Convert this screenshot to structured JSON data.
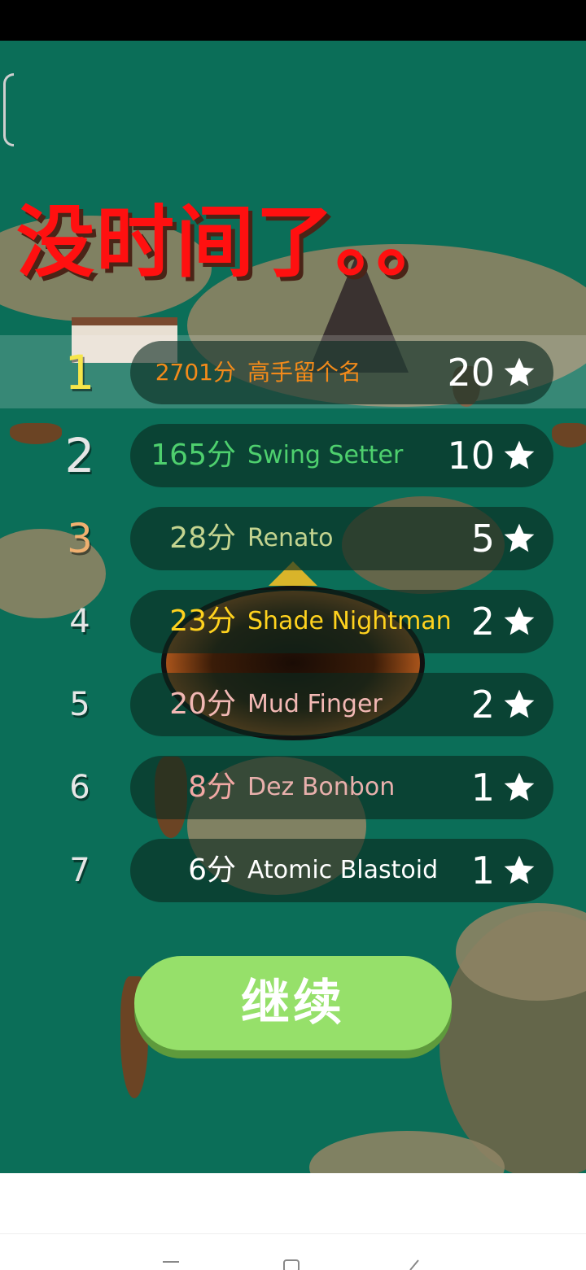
{
  "title": "没时间了。。",
  "leaderboard": [
    {
      "rank": "1",
      "score": "2701分",
      "name": "高手留个名",
      "stars": "20",
      "rank_color": "#f6e64a",
      "score_color": "#f28a1a",
      "name_color": "#f28a1a",
      "highlight": true
    },
    {
      "rank": "2",
      "score": "165分",
      "name": "Swing Setter",
      "stars": "10",
      "rank_color": "#e6e6e6",
      "score_color": "#4ed06e",
      "name_color": "#4ed06e",
      "highlight": false
    },
    {
      "rank": "3",
      "score": "28分",
      "name": "Renato",
      "stars": "5",
      "rank_color": "#f0b070",
      "score_color": "#c4d490",
      "name_color": "#c4d490",
      "highlight": false
    },
    {
      "rank": "4",
      "score": "23分",
      "name": "Shade Nightman",
      "stars": "2",
      "rank_color": "#e6e6e6",
      "score_color": "#ffd21e",
      "name_color": "#ffd21e",
      "highlight": false
    },
    {
      "rank": "5",
      "score": "20分",
      "name": "Mud Finger",
      "stars": "2",
      "rank_color": "#e6e6e6",
      "score_color": "#f2b8b4",
      "name_color": "#f2b8b4",
      "highlight": false
    },
    {
      "rank": "6",
      "score": "8分",
      "name": "Dez Bonbon",
      "stars": "1",
      "rank_color": "#e6e6e6",
      "score_color": "#f2a8a4",
      "name_color": "#e8b0ac",
      "highlight": false
    },
    {
      "rank": "7",
      "score": "6分",
      "name": "Atomic Blastoid",
      "stars": "1",
      "rank_color": "#e6e6e6",
      "score_color": "#ffffff",
      "name_color": "#ffffff",
      "highlight": false
    }
  ],
  "continue_button": {
    "label": "继续"
  },
  "icons": {
    "star": "star-icon",
    "nav_menu": "menu-icon",
    "nav_home": "home-icon",
    "nav_back": "back-icon"
  },
  "colors": {
    "background": "#0b6e58",
    "title": "#ff1010",
    "button": "#96e06a"
  }
}
